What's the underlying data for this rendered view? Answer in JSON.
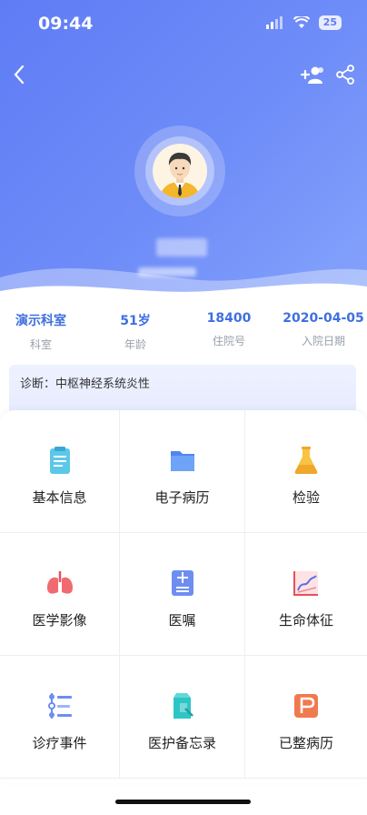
{
  "status_bar": {
    "time": "09:44",
    "battery": "25"
  },
  "nav": {
    "back_icon": "chevron-left-icon",
    "add_icon": "add-user-icon",
    "share_icon": "share-icon"
  },
  "colors": {
    "header": "#6f8df8",
    "accent": "#3f6fe0",
    "label": "#9aa0ab"
  },
  "patient": {
    "stats": [
      {
        "value": "演示科室",
        "label": "科室"
      },
      {
        "value": "51岁",
        "label": "年龄"
      },
      {
        "value": "18400",
        "label": "住院号"
      },
      {
        "value": "2020-04-05",
        "label": "入院日期"
      }
    ],
    "diagnosis": "诊断：中枢神经系统炎性"
  },
  "menu": [
    {
      "label": "基本信息",
      "icon": "clipboard-icon"
    },
    {
      "label": "电子病历",
      "icon": "folder-icon"
    },
    {
      "label": "检验",
      "icon": "flask-icon"
    },
    {
      "label": "医学影像",
      "icon": "lungs-icon"
    },
    {
      "label": "医嘱",
      "icon": "order-sheet-icon"
    },
    {
      "label": "生命体征",
      "icon": "vital-chart-icon"
    },
    {
      "label": "诊疗事件",
      "icon": "timeline-icon"
    },
    {
      "label": "医护备忘录",
      "icon": "memo-icon"
    },
    {
      "label": "已整病历",
      "icon": "archived-record-icon"
    }
  ]
}
